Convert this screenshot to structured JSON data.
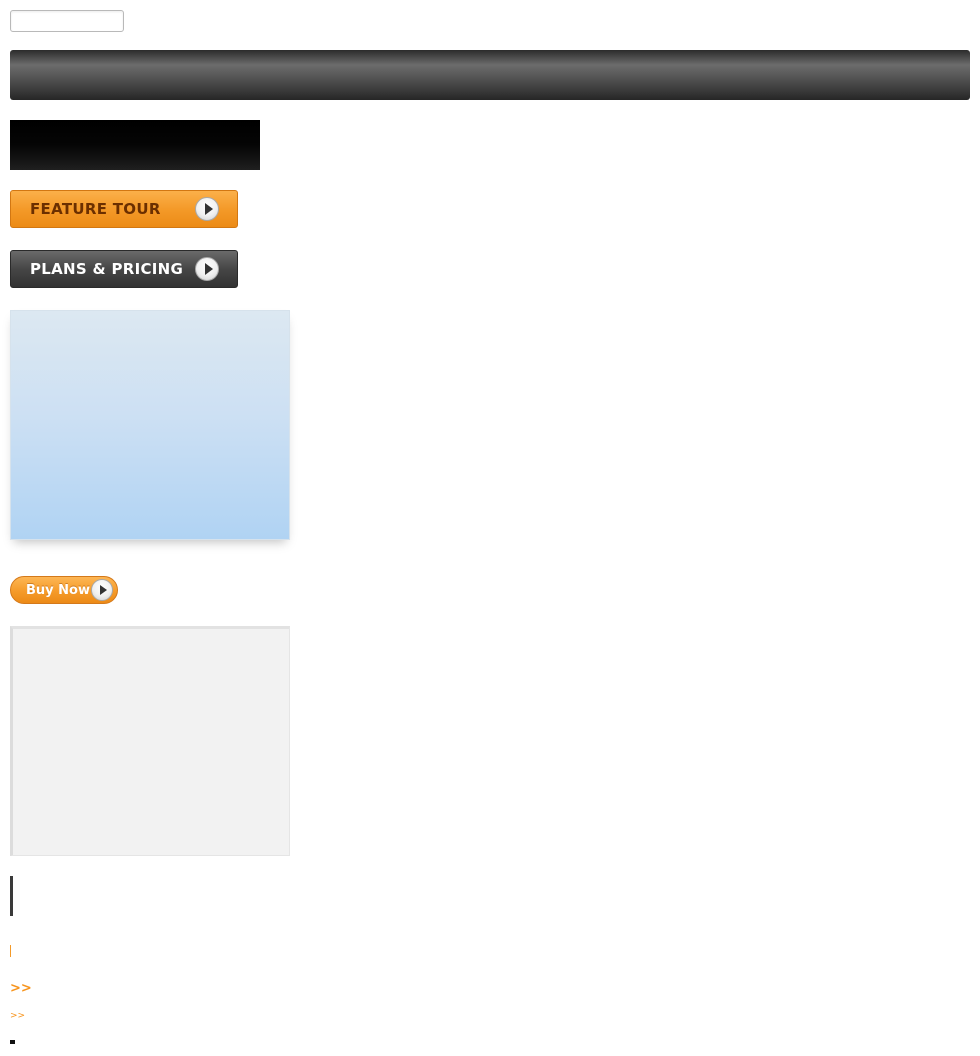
{
  "search": {
    "value": "",
    "placeholder": ""
  },
  "buttons": {
    "feature_tour": "FEATURE TOUR",
    "plans_pricing": "PLANS & PRICING",
    "buy_now": "Buy Now"
  },
  "links": {
    "more_arrow_large": ">>",
    "more_arrow_small": ">>"
  },
  "icons": {
    "play": "play-circle-icon"
  },
  "colors": {
    "accent_orange": "#f49a29",
    "dark_button": "#464646",
    "blue_panel": "#cde0f3",
    "gray_panel": "#f2f2f2"
  }
}
